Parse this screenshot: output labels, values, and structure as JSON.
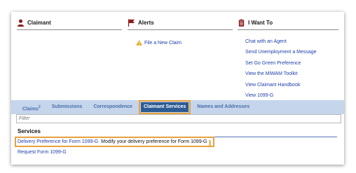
{
  "panels": {
    "claimant": {
      "title": "Claimant"
    },
    "alerts": {
      "title": "Alerts",
      "items": [
        "File a New Claim"
      ]
    },
    "iwant": {
      "title": "I Want To",
      "items": [
        "Chat with an Agent",
        "Send Unemployment a Message",
        "Set Go Green Preference",
        "View the MiWAM Toolkit",
        "View Claimant Handbook",
        "View 1099-G"
      ]
    }
  },
  "tabs": [
    {
      "label": "Claims",
      "sup": "2"
    },
    {
      "label": "Submissions",
      "sup": ""
    },
    {
      "label": "Correspondence",
      "sup": ""
    },
    {
      "label": "Claimant Services",
      "sup": ""
    },
    {
      "label": "Names and Addresses",
      "sup": ""
    }
  ],
  "active_tab": "Claimant Services",
  "filter": {
    "placeholder": "Filter"
  },
  "services": {
    "title": "Services",
    "rows": [
      {
        "link": "Delivery Preference for Form 1099-G",
        "desc": "Modify your delivery preference for Form 1099-G"
      },
      {
        "link": "Request Form 1099-G",
        "desc": ""
      }
    ]
  },
  "colors": {
    "accent_highlight": "#e6a23c",
    "tab_bar": "#c5d5ec",
    "active_tab": "#2e5b94",
    "link": "#1f3fa8",
    "icon_red": "#8b1a1a"
  }
}
